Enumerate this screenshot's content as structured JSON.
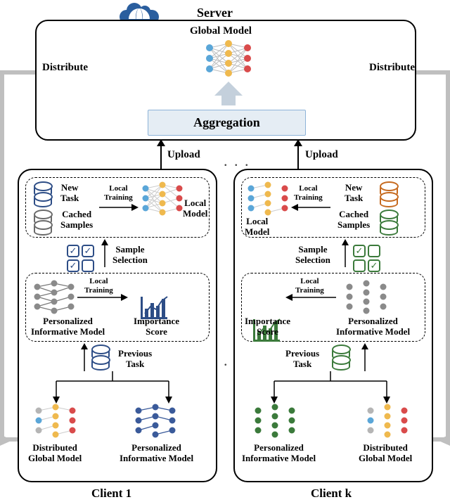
{
  "server": {
    "title": "Server",
    "global_model": "Global Model",
    "aggregation": "Aggregation",
    "distribute_left": "Distribute",
    "distribute_right": "Distribute",
    "upload_left": "Upload",
    "upload_right": "Upload"
  },
  "dots_top": ". . .",
  "dots_mid": ". . .",
  "clients": [
    {
      "title": "Client 1",
      "color": "blue",
      "new_task": "New\nTask",
      "cached_samples": "Cached\nSamples",
      "local_training_top": "Local\nTraining",
      "local_model": "Local\nModel",
      "sample_selection": "Sample\nSelection",
      "local_training_mid": "Local\nTraining",
      "importance_score": "Importance\nScore",
      "pim": "Personalized\nInformative Model",
      "previous_task": "Previous\nTask",
      "dgm": "Distributed\nGlobal Model",
      "pim2": "Personalized\nInformative Model"
    },
    {
      "title": "Client k",
      "color": "green",
      "new_task": "New\nTask",
      "cached_samples": "Cached\nSamples",
      "local_training_top": "Local\nTraining",
      "local_model": "Local\nModel",
      "sample_selection": "Sample\nSelection",
      "local_training_mid": "Local\nTraining",
      "importance_score": "Importance\nScore",
      "pim": "Personalized\nInformative Model",
      "previous_task": "Previous\nTask",
      "dgm": "Distributed\nGlobal Model",
      "pim2": "Personalized\nInformative Model"
    }
  ]
}
